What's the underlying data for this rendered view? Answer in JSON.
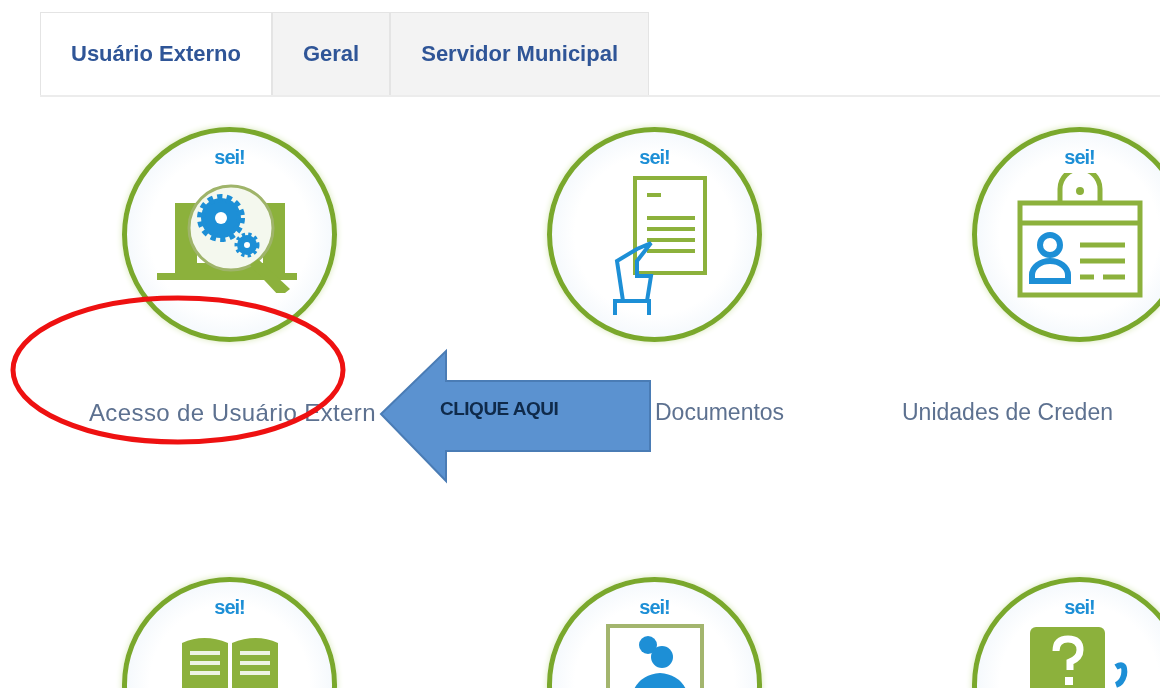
{
  "tabs": [
    {
      "label": "Usuário Externo",
      "selected": true
    },
    {
      "label": "Geral",
      "selected": false
    },
    {
      "label": "Servidor Municipal",
      "selected": false
    }
  ],
  "tiles": [
    {
      "kind": "gears",
      "logo": "sei!",
      "label": "Acesso de Usuário Extern"
    },
    {
      "kind": "document",
      "logo": "sei!",
      "label": "Documentos"
    },
    {
      "kind": "badge",
      "logo": "sei!",
      "label": "Unidades de Creden"
    },
    {
      "kind": "book",
      "logo": "sei!"
    },
    {
      "kind": "people",
      "logo": "sei!"
    },
    {
      "kind": "help",
      "logo": "sei!"
    }
  ],
  "annotations": [
    {
      "kind": "ellipse"
    },
    {
      "kind": "arrow",
      "text": "CLIQUE AQUI"
    }
  ]
}
